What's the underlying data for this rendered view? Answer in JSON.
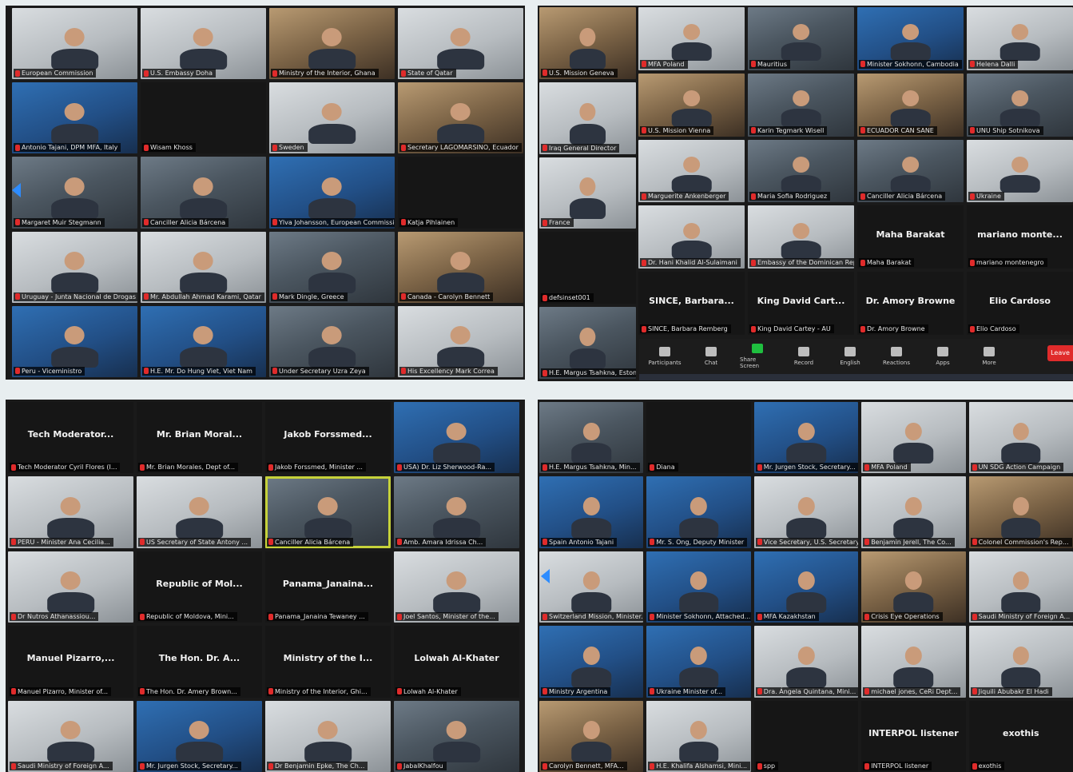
{
  "panels": {
    "top_left": [
      {
        "label": "European Commission",
        "k": "cam light"
      },
      {
        "label": "U.S. Embassy Doha",
        "k": "cam light"
      },
      {
        "label": "Ministry of the Interior, Ghana",
        "k": "cam warm"
      },
      {
        "label": "State of Qatar",
        "k": "cam light"
      },
      {
        "label": "Antonio Tajani, DPM MFA, Italy",
        "k": "cam blue",
        "big": ""
      },
      {
        "label": "Wisam Khoss",
        "k": "dark"
      },
      {
        "label": "Sweden",
        "k": "cam light"
      },
      {
        "label": "Secretary LAGOMARSINO, Ecuador",
        "k": "cam warm"
      },
      {
        "label": "Margaret Muir Stegmann",
        "k": "cam"
      },
      {
        "label": "Canciller Alicia Bárcena",
        "k": "cam"
      },
      {
        "label": "Ylva Johansson, European Commission",
        "k": "cam blue"
      },
      {
        "label": "Katja Pihlainen",
        "k": "dark"
      },
      {
        "label": "Uruguay - Junta Nacional de Drogas",
        "k": "cam light"
      },
      {
        "label": "Mr. Abdullah Ahmad Karami, Qatar",
        "k": "cam light"
      },
      {
        "label": "Mark Dingle, Greece",
        "k": "cam"
      },
      {
        "label": "Canada - Carolyn Bennett",
        "k": "cam warm"
      },
      {
        "label": "Peru - Viceministro",
        "k": "cam blue"
      },
      {
        "label": "H.E. Mr. Do Hung Viet, Viet Nam",
        "k": "cam blue"
      },
      {
        "label": "Under Secretary Uzra Zeya",
        "k": "cam"
      },
      {
        "label": "His Excellency Mark Correa",
        "k": "cam light"
      }
    ],
    "top_right_left_col": [
      {
        "label": "U.S. Mission Geneva",
        "k": "cam warm"
      },
      {
        "label": "Iraq General Director",
        "k": "cam light"
      },
      {
        "label": "France",
        "k": "cam light"
      },
      {
        "label": "defsinset001",
        "k": "dark"
      },
      {
        "label": "H.E. Margus Tsahkna, Estonia",
        "k": "cam"
      }
    ],
    "top_right": [
      {
        "label": "MFA Poland",
        "k": "cam light"
      },
      {
        "label": "Mauritius",
        "k": "cam"
      },
      {
        "label": "Minister Sokhonn, Cambodia",
        "k": "cam blue"
      },
      {
        "label": "Helena Dalli",
        "k": "cam light"
      },
      {
        "label": "U.S. Mission Vienna",
        "k": "cam warm"
      },
      {
        "label": "Karin Tegmark Wisell",
        "k": "cam"
      },
      {
        "label": "ECUADOR CAN SANE",
        "k": "cam warm"
      },
      {
        "label": "UNU Ship Sotnikova",
        "k": "cam"
      },
      {
        "label": "Marguerite Ankenberger",
        "k": "cam light"
      },
      {
        "label": "Maria Sofia Rodriguez",
        "k": "cam"
      },
      {
        "label": "Canciller Alicia Bárcena",
        "k": "cam"
      },
      {
        "label": "Ukraine",
        "k": "cam light"
      },
      {
        "label": "Dr. Hani Khalid Al-Sulaimani",
        "k": "cam light"
      },
      {
        "label": "Embassy of the Dominican Republic",
        "k": "cam light"
      },
      {
        "label": "Maha Barakat",
        "k": "dark",
        "big": "Maha Barakat"
      },
      {
        "label": "mariano montenegro",
        "k": "dark",
        "big": "mariano monte..."
      },
      {
        "label": "SINCE, Barbara Remberg",
        "k": "dark",
        "big": "SINCE, Barbara..."
      },
      {
        "label": "King David Cartey - AU",
        "k": "dark",
        "big": "King David Cart..."
      },
      {
        "label": "Dr. Amory Browne",
        "k": "dark",
        "big": "Dr. Amory Browne"
      },
      {
        "label": "Elio Cardoso",
        "k": "dark",
        "big": "Elio Cardoso"
      }
    ],
    "toolbar": [
      "Participants",
      "Chat",
      "Share Screen",
      "Record",
      "English",
      "Reactions",
      "Apps",
      "More"
    ],
    "end_label": "Leave",
    "bottom_left": [
      {
        "label": "Tech Moderator Cyril Flores (I...",
        "k": "dark",
        "big": "Tech Moderator..."
      },
      {
        "label": "Mr. Brian Morales, Dept of...",
        "k": "dark",
        "big": "Mr. Brian Moral..."
      },
      {
        "label": "Jakob Forssmed, Minister ...",
        "k": "dark",
        "big": "Jakob Forssmed..."
      },
      {
        "label": "USA) Dr. Liz Sherwood-Ra...",
        "k": "cam blue"
      },
      {
        "label": "PERU - Minister Ana Cecilia...",
        "k": "cam light"
      },
      {
        "label": "US Secretary of State Antony ...",
        "k": "cam light"
      },
      {
        "label": "Canciller Alicia Bárcena",
        "k": "cam",
        "active": true
      },
      {
        "label": "Amb. Amara Idrissa Ch...",
        "k": "cam"
      },
      {
        "label": "Dr Nutros Athanassiou...",
        "k": "cam light"
      },
      {
        "label": "Republic of Moldova, Mini...",
        "k": "dark",
        "big": "Republic of Mol..."
      },
      {
        "label": "Panama_Janaina Tewaney ...",
        "k": "dark",
        "big": "Panama_Janaina..."
      },
      {
        "label": "Joel Santos, Minister of the...",
        "k": "cam light"
      },
      {
        "label": "Manuel Pizarro, Minister of...",
        "k": "dark",
        "big": "Manuel Pizarro,..."
      },
      {
        "label": "The Hon. Dr. Amery Brown...",
        "k": "dark",
        "big": "The Hon. Dr. A..."
      },
      {
        "label": "Ministry of the Interior, Ghi...",
        "k": "dark",
        "big": "Ministry of the I..."
      },
      {
        "label": "Lolwah Al-Khater",
        "k": "dark",
        "big": "Lolwah Al-Khater"
      },
      {
        "label": "Saudi Ministry of Foreign A...",
        "k": "cam light"
      },
      {
        "label": "Mr. Jurgen Stock, Secretary...",
        "k": "cam blue"
      },
      {
        "label": "Dr Benjamin Epke, The Ch...",
        "k": "cam light"
      },
      {
        "label": "JabalKhalfou",
        "k": "cam"
      }
    ],
    "bottom_right": [
      {
        "label": "H.E. Margus Tsahkna, Min...",
        "k": "cam"
      },
      {
        "label": "Diana",
        "k": "dark"
      },
      {
        "label": "Mr. Jurgen Stock, Secretary...",
        "k": "cam blue"
      },
      {
        "label": "MFA Poland",
        "k": "cam light"
      },
      {
        "label": "UN SDG Action Campaign",
        "k": "cam light"
      },
      {
        "label": "Spain Antonio Tajani",
        "k": "cam blue"
      },
      {
        "label": "Mr. S. Ong, Deputy Minister",
        "k": "cam blue"
      },
      {
        "label": "Vice Secretary, U.S. Secretary...",
        "k": "cam light"
      },
      {
        "label": "Benjamin Jerell, The Co...",
        "k": "cam light"
      },
      {
        "label": "Colonel Commission's Rep...",
        "k": "cam warm"
      },
      {
        "label": "Switzerland Mission, Minister...",
        "k": "cam light"
      },
      {
        "label": "Minister Sokhonn, Attached...",
        "k": "cam blue"
      },
      {
        "label": "MFA Kazakhstan",
        "k": "cam blue"
      },
      {
        "label": "Crisis Eye Operations",
        "k": "cam warm"
      },
      {
        "label": "Saudi Ministry of Foreign A...",
        "k": "cam light"
      },
      {
        "label": "Ministry Argentina",
        "k": "cam blue"
      },
      {
        "label": "Ukraine Minister of...",
        "k": "cam blue"
      },
      {
        "label": "Dra. Ángela Quintana, Mini...",
        "k": "cam light"
      },
      {
        "label": "michael jones, CeRi Dept...",
        "k": "cam light"
      },
      {
        "label": "Jiquili Abubakr El Hadi",
        "k": "cam light"
      },
      {
        "label": "Carolyn Bennett, MFA...",
        "k": "cam warm"
      },
      {
        "label": "H.E. Khalifa Alshamsi, Mini...",
        "k": "cam light"
      },
      {
        "label": "spp",
        "k": "dark"
      },
      {
        "label": "INTERPOL listener",
        "k": "dark",
        "big": "INTERPOL listener"
      },
      {
        "label": "exothis",
        "k": "dark",
        "big": "exothis"
      }
    ]
  }
}
